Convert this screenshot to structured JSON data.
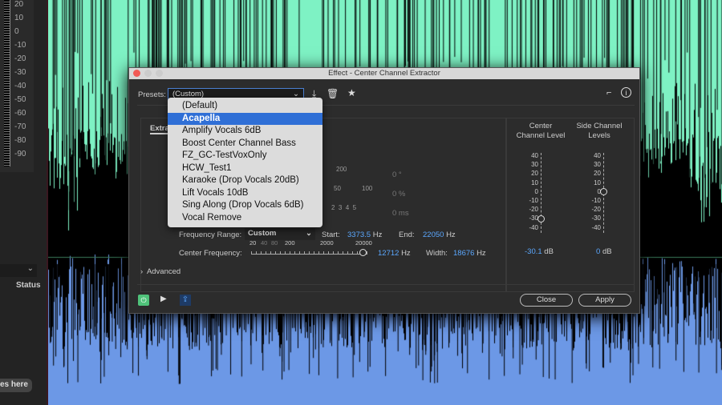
{
  "colors": {
    "waveform_top": "#7ef2c4",
    "waveform_bottom": "#6c98e6",
    "accent": "#5ba8ff",
    "selected": "#2f6fd6"
  },
  "left_panel": {
    "ruler_labels": [
      "20",
      "10",
      "0",
      "-10",
      "-20",
      "-30",
      "-40",
      "-50",
      "-60",
      "-70",
      "-80",
      "-90"
    ],
    "status_header": "Status",
    "drop_hint": "les here"
  },
  "dialog": {
    "title": "Effect - Center Channel Extractor",
    "presets_label": "Presets:",
    "presets_value": "(Custom)",
    "presets_options": [
      "(Default)",
      "Acapella",
      "Amplify Vocals 6dB",
      "Boost Center Channel Bass",
      "FZ_GC-TestVoxOnly",
      "HCW_Test1",
      "Karaoke (Drop Vocals 20dB)",
      "Lift Vocals 10dB",
      "Sing Along (Drop Vocals 6dB)",
      "Vocal Remove"
    ],
    "highlighted_option": "Acapella",
    "tab_label": "Extra",
    "hidden_values": {
      "scale1": "200",
      "val1": "0 °",
      "scale2a": "50",
      "scale2b": "100",
      "val2": "0 %",
      "scale3": "2  3  4  5",
      "val3": "0 ms"
    },
    "frequency_range_label": "Frequency Range:",
    "frequency_range_value": "Custom",
    "start_label": "Start:",
    "start_value": "3373.5",
    "start_unit": "Hz",
    "end_label": "End:",
    "end_value": "22050",
    "end_unit": "Hz",
    "center_freq_label": "Center Frequency:",
    "center_freq_ticks": [
      "20",
      "40",
      "80",
      "200",
      "2000",
      "20000"
    ],
    "center_freq_value": "12712",
    "center_freq_unit": "Hz",
    "width_label": "Width:",
    "width_value": "18676",
    "width_unit": "Hz",
    "center_level_title": "Center Channel Level",
    "side_level_title": "Side Channel Levels",
    "level_ticks": [
      "40",
      "30",
      "20",
      "10",
      "0",
      "-10",
      "-20",
      "-30",
      "-40"
    ],
    "center_level_value": "-30.1",
    "center_level_db": -30.1,
    "side_level_value": "0",
    "side_level_db": 0,
    "db_unit": "dB",
    "advanced_label": "Advanced",
    "close_label": "Close",
    "apply_label": "Apply"
  }
}
